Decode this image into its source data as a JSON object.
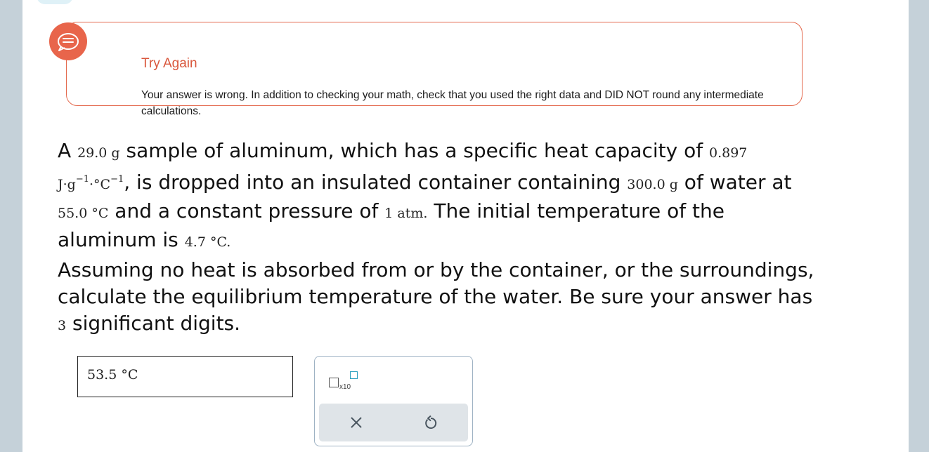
{
  "feedback": {
    "icon": "chat-bubble-icon",
    "title": "Try Again",
    "message": "Your answer is wrong. In addition to checking your math, check that you used the right data and DID NOT round any intermediate calculations."
  },
  "question": {
    "p1_a": "A ",
    "mass_al": "29.0 g",
    "p1_b": " sample of aluminum, which has a specific heat capacity of ",
    "cp_value": "0.897",
    "cp_j": "J·g",
    "cp_exp1": "−1",
    "cp_degc": "·°C",
    "cp_exp2": "−1",
    "p1_c": ", is dropped into an insulated container containing ",
    "mass_water": "300.0 g",
    "p1_d": " of water at ",
    "temp_water": "55.0 °C",
    "p1_e": " and a constant pressure of ",
    "pressure": "1 atm.",
    "p1_f": " The initial temperature of the aluminum is ",
    "temp_al": "4.7 °C.",
    "p2_a": "Assuming no heat is absorbed from or by the container, or the surroundings, calculate the equilibrium temperature of the water. Be sure your answer has ",
    "sig_figs": "3",
    "p2_b": " significant digits."
  },
  "answer": {
    "value": "53.5 °C"
  },
  "tools": {
    "sci_notation_label": "x10",
    "clear_icon": "close-icon",
    "undo_icon": "undo-icon",
    "accent_color": "#2a9fbf"
  },
  "colors": {
    "feedback_accent": "#e8654b",
    "page_bg": "#c5d1d9"
  }
}
